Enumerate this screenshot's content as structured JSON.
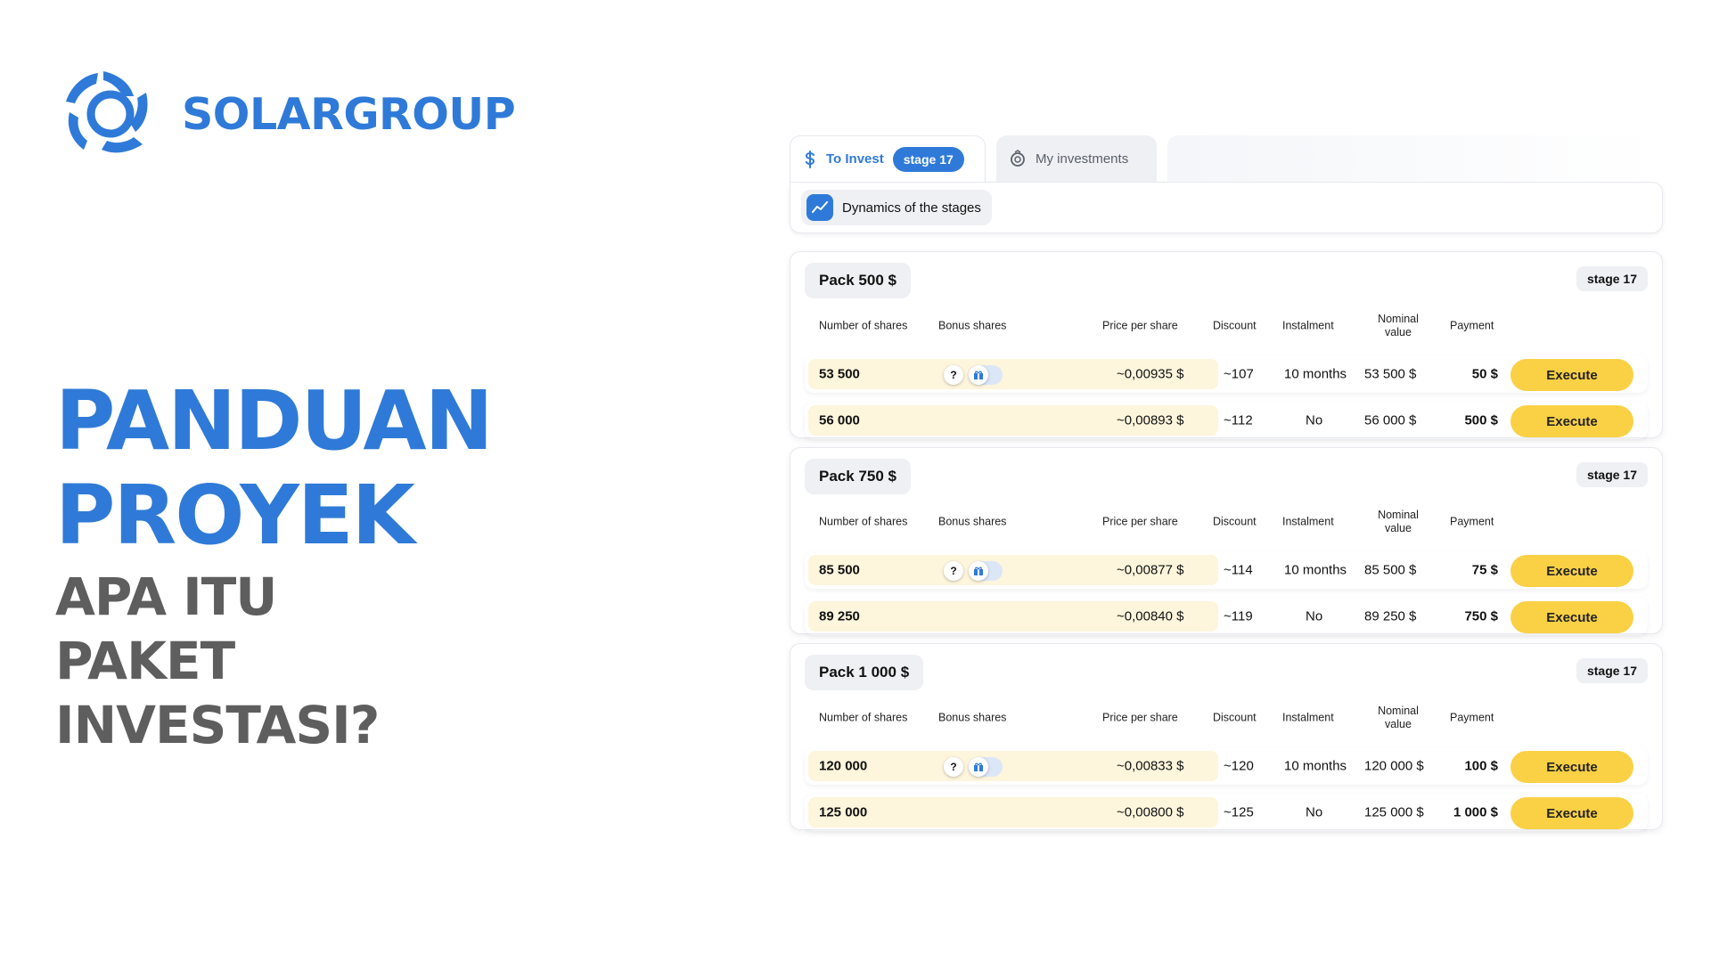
{
  "brand": {
    "name": "SOLARGROUP",
    "color": "#2f7ad8"
  },
  "headline": {
    "line1": "PANDUAN",
    "line2": "PROYEK"
  },
  "subline": {
    "line1": "APA ITU",
    "line2": "PAKET",
    "line3": "INVESTASI?"
  },
  "tabs": {
    "invest_label": "To Invest",
    "invest_stage": "stage 17",
    "my_label": "My investments"
  },
  "dynamics_label": "Dynamics of the stages",
  "columns": {
    "shares": "Number of shares",
    "bonus": "Bonus shares",
    "price": "Price per share",
    "discount": "Discount",
    "instalment": "Instalment",
    "nominal": "Nominal value",
    "payment": "Payment"
  },
  "packs": [
    {
      "title": "Pack 500 $",
      "stage": "stage 17",
      "rows": [
        {
          "shares": "53 500",
          "bonus": "?",
          "price": "~0,00935 $",
          "discount": "~107",
          "instalment": "10 months",
          "nominal": "53 500 $",
          "payment": "50 $",
          "action": "Execute"
        },
        {
          "shares": "56 000",
          "bonus": "",
          "price": "~0,00893 $",
          "discount": "~112",
          "instalment": "No",
          "nominal": "56 000 $",
          "payment": "500 $",
          "action": "Execute"
        }
      ]
    },
    {
      "title": "Pack 750 $",
      "stage": "stage 17",
      "rows": [
        {
          "shares": "85 500",
          "bonus": "?",
          "price": "~0,00877 $",
          "discount": "~114",
          "instalment": "10 months",
          "nominal": "85 500 $",
          "payment": "75 $",
          "action": "Execute"
        },
        {
          "shares": "89 250",
          "bonus": "",
          "price": "~0,00840 $",
          "discount": "~119",
          "instalment": "No",
          "nominal": "89 250 $",
          "payment": "750 $",
          "action": "Execute"
        }
      ]
    },
    {
      "title": "Pack 1 000 $",
      "stage": "stage 17",
      "rows": [
        {
          "shares": "120 000",
          "bonus": "?",
          "price": "~0,00833 $",
          "discount": "~120",
          "instalment": "10 months",
          "nominal": "120 000 $",
          "payment": "100 $",
          "action": "Execute"
        },
        {
          "shares": "125 000",
          "bonus": "",
          "price": "~0,00800 $",
          "discount": "~125",
          "instalment": "No",
          "nominal": "125 000 $",
          "payment": "1 000 $",
          "action": "Execute"
        }
      ]
    }
  ]
}
